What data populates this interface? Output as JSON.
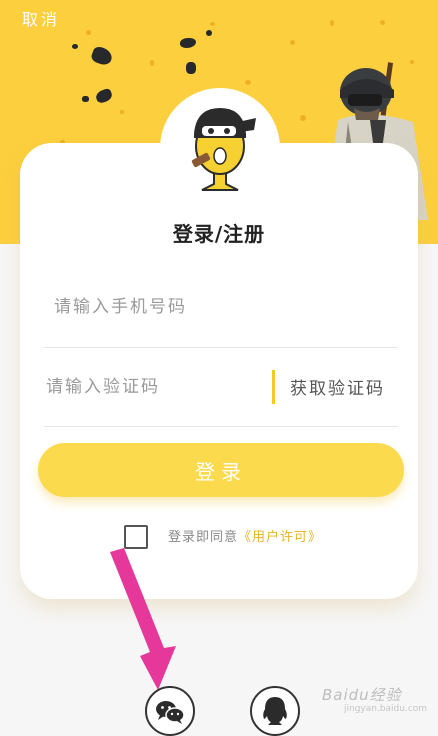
{
  "header": {
    "cancel_label": "取消"
  },
  "login": {
    "title": "登录/注册",
    "phone_placeholder": "请输入手机号码",
    "code_placeholder": "请输入验证码",
    "get_code_label": "获取验证码",
    "submit_label": "登录"
  },
  "agreement": {
    "text": "登录即同意",
    "link": "《用户许可》",
    "checked": false
  },
  "social": [
    {
      "name": "wechat",
      "icon": "wechat-icon"
    },
    {
      "name": "qq",
      "icon": "qq-icon"
    }
  ],
  "watermark": {
    "brand": "Baidu经验",
    "url": "jingyan.baidu.com"
  },
  "colors": {
    "accent_yellow": "#fccf3e",
    "button_yellow": "#fbda4d",
    "link_gold": "#e7b427",
    "arrow_pink": "#e6389a"
  }
}
